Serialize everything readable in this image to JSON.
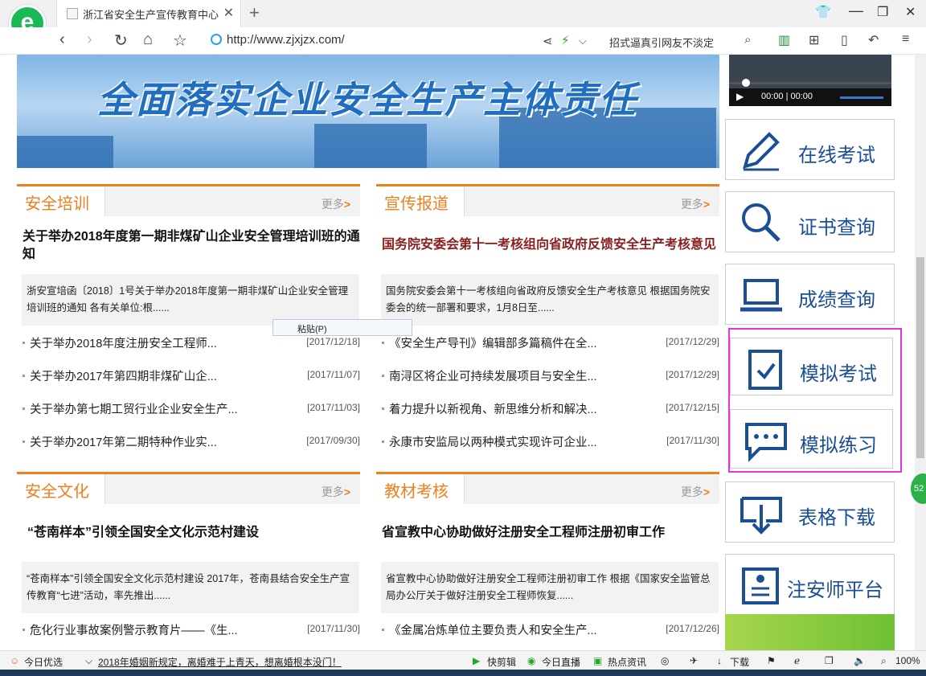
{
  "browser": {
    "tab_title": "浙江省安全生产宣传教育中心",
    "url": "http://www.zjxjzx.com/",
    "search_text": "招式逼真引网友不淡定"
  },
  "banner": {
    "slogan": "全面落实企业安全生产主体责任"
  },
  "video": {
    "time": "00:00 | 00:00"
  },
  "context_menu": {
    "paste": "粘贴(P)"
  },
  "sections": [
    {
      "name": "安全培训",
      "more": "更多",
      "headline": "关于举办2018年度第一期非煤矿山企业安全管理培训班的通知",
      "summary": "浙安宣培函〔2018〕1号关于举办2018年度第一期非煤矿山企业安全管理培训班的通知 各有关单位:根......",
      "items": [
        {
          "title": "关于举办2018年度注册安全工程师...",
          "date": "[2017/12/18]"
        },
        {
          "title": "关于举办2017年第四期非煤矿山企...",
          "date": "[2017/11/07]"
        },
        {
          "title": "关于举办第七期工贸行业企业安全生产...",
          "date": "[2017/11/03]"
        },
        {
          "title": "关于举办2017年第二期特种作业实...",
          "date": "[2017/09/30]"
        }
      ]
    },
    {
      "name": "宣传报道",
      "more": "更多",
      "headline": "国务院安委会第十一考核组向省政府反馈安全生产考核意见",
      "summary": "国务院安委会第十一考核组向省政府反馈安全生产考核意见  根据国务院安委会的统一部署和要求，1月8日至......",
      "items": [
        {
          "title": "《安全生产导刊》编辑部多篇稿件在全...",
          "date": "[2017/12/29]"
        },
        {
          "title": "南浔区将企业可持续发展项目与安全生...",
          "date": "[2017/12/29]"
        },
        {
          "title": "着力提升以新视角、新思维分析和解决...",
          "date": "[2017/12/15]"
        },
        {
          "title": "永康市安监局以两种模式实现许可企业...",
          "date": "[2017/11/30]"
        }
      ]
    },
    {
      "name": "安全文化",
      "more": "更多",
      "headline": "“苍南样本”引领全国安全文化示范村建设",
      "summary": "“苍南样本”引领全国安全文化示范村建设 2017年，苍南县结合安全生产宣传教育“七进”活动，率先推出......",
      "items": [
        {
          "title": "危化行业事故案例警示教育片——《生...",
          "date": "[2017/11/30]"
        }
      ]
    },
    {
      "name": "教材考核",
      "more": "更多",
      "headline": "省宣教中心协助做好注册安全工程师注册初审工作",
      "summary": "省宣教中心协助做好注册安全工程师注册初审工作 根据《国家安全监管总局办公厅关于做好注册安全工程师恢复......",
      "items": [
        {
          "title": "《金属冶炼单位主要负责人和安全生产...",
          "date": "[2017/12/26]"
        }
      ]
    }
  ],
  "right_buttons": [
    {
      "label": "在线考试",
      "icon": "pencil-icon"
    },
    {
      "label": "证书查询",
      "icon": "magnifier-icon"
    },
    {
      "label": "成绩查询",
      "icon": "laptop-icon"
    },
    {
      "label": "模拟考试",
      "icon": "clipboard-check-icon"
    },
    {
      "label": "模拟练习",
      "icon": "chat-bubble-icon"
    },
    {
      "label": "表格下载",
      "icon": "download-tray-icon"
    },
    {
      "label": "注安师平台",
      "icon": "id-card-icon"
    }
  ],
  "side_badge": "52",
  "statusbar": {
    "today": "今日优选",
    "news": "2018年婚姻新规定，离婚难于上青天，想离婚根本没门！",
    "quick_clip": "快剪辑",
    "live": "今日直播",
    "hot": "热点资讯",
    "download": "下载",
    "zoom": "100%"
  },
  "colors": {
    "accent_orange": "#ef7e1c",
    "button_blue": "#1a4f96",
    "highlight_magenta": "#e234e2"
  }
}
